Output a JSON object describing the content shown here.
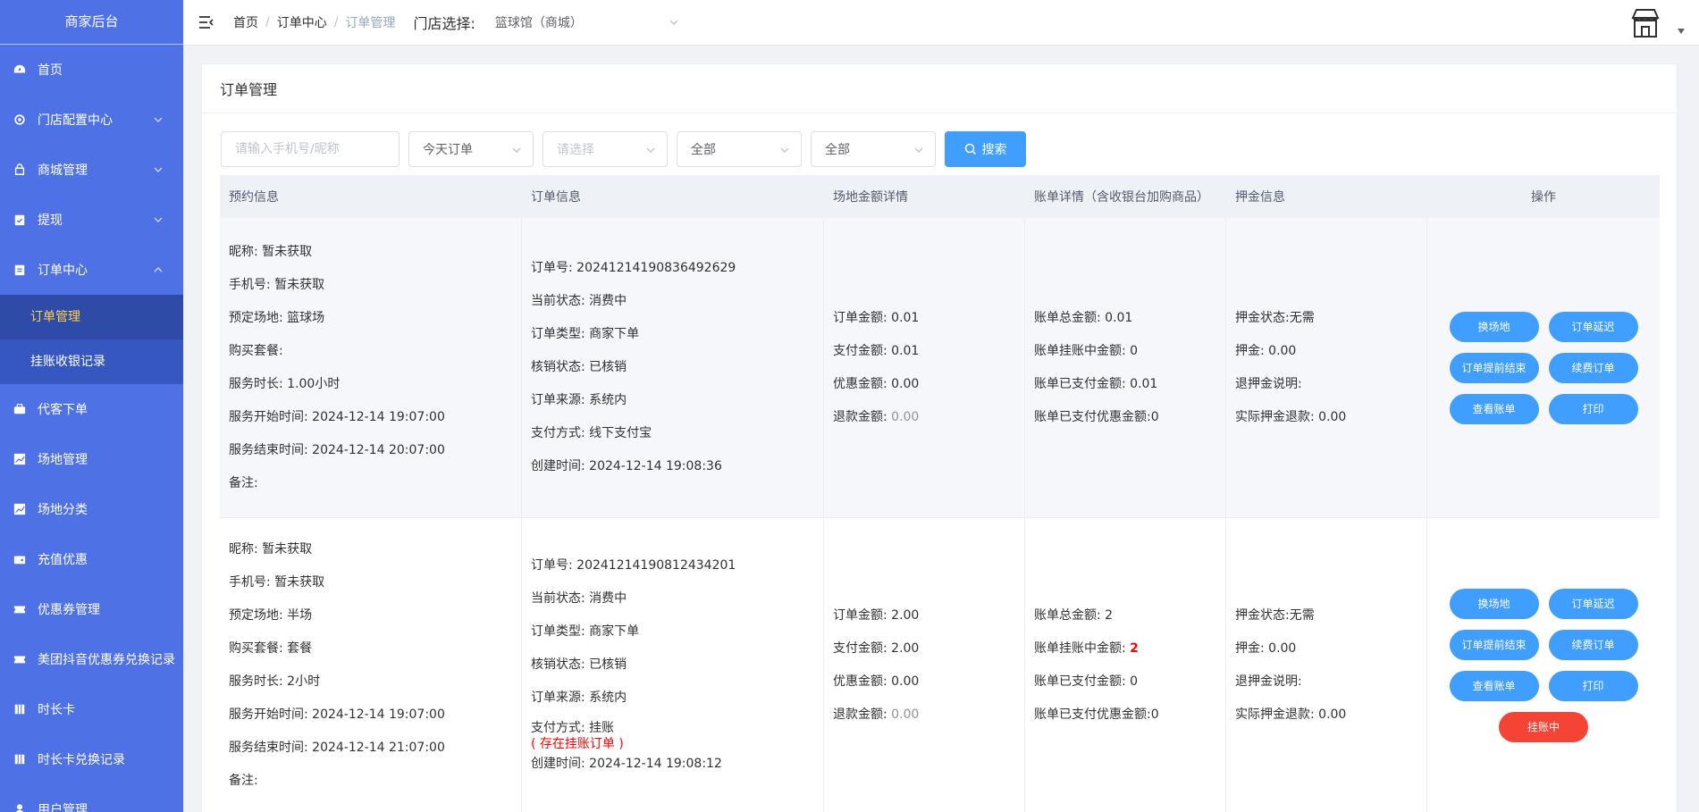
{
  "sidebar": {
    "brand": "商家后台",
    "items": [
      {
        "label": "首页",
        "icon": "dashboard-icon"
      },
      {
        "label": "门店配置中心",
        "icon": "gear-icon"
      },
      {
        "label": "商城管理",
        "icon": "shop-icon"
      },
      {
        "label": "提现",
        "icon": "clipboard-check-icon"
      },
      {
        "label": "订单中心",
        "icon": "clipboard-icon"
      },
      {
        "label": "代客下单",
        "icon": "briefcase-icon"
      },
      {
        "label": "场地管理",
        "icon": "chart-icon"
      },
      {
        "label": "场地分类",
        "icon": "chart-icon"
      },
      {
        "label": "充值优惠",
        "icon": "wallet-icon"
      },
      {
        "label": "优惠券管理",
        "icon": "ticket-icon"
      },
      {
        "label": "美团抖音优惠券兑换记录",
        "icon": "ticket-icon"
      },
      {
        "label": "时长卡",
        "icon": "card-icon"
      },
      {
        "label": "时长卡兑换记录",
        "icon": "card-icon"
      },
      {
        "label": "用户管理",
        "icon": "user-icon"
      }
    ],
    "order_sub": [
      "订单管理",
      "挂账收银记录"
    ]
  },
  "header": {
    "breadcrumb": [
      "首页",
      "订单中心",
      "订单管理"
    ],
    "store_label": "门店选择:",
    "store_value": "篮球馆（商城）"
  },
  "card": {
    "title": "订单管理"
  },
  "filters": {
    "phone_placeholder": "请输入手机号/昵称",
    "date_range": "今天订单",
    "select_placeholder": "请选择",
    "status1": "全部",
    "status2": "全部",
    "search_label": "搜索"
  },
  "table": {
    "headers": [
      "预约信息",
      "订单信息",
      "场地金额详情",
      "账单详情（含收银台加购商品）",
      "押金信息",
      "操作"
    ],
    "rows": [
      {
        "booking": [
          "昵称: 暂未获取",
          "手机号: 暂未获取",
          "预定场地: 篮球场",
          "购买套餐:",
          "服务时长: 1.00小时",
          "服务开始时间: 2024-12-14 19:07:00",
          "服务结束时间: 2024-12-14 20:07:00",
          "备注:"
        ],
        "order": [
          "订单号: 20241214190836492629",
          "当前状态: 消费中",
          "订单类型: 商家下单",
          "核销状态: 已核销",
          "订单来源: 系统内",
          "支付方式: 线下支付宝",
          "创建时间: 2024-12-14 19:08:36"
        ],
        "amount": {
          "order_amount": "订单金额: 0.01",
          "paid": "支付金额: 0.01",
          "discount": "优惠金额: 0.00",
          "refund_label": "退款金额: ",
          "refund_value": "0.00"
        },
        "bill": {
          "total": "账单总金额: 0.01",
          "pending_label": "账单挂账中金额: ",
          "pending_value": "0",
          "paid": "账单已支付金额: 0.01",
          "paid_discount": "账单已支付优惠金额:0"
        },
        "deposit": [
          "押金状态:无需",
          "押金: 0.00",
          "退押金说明:",
          "实际押金退款: 0.00"
        ],
        "ops": [
          "换场地",
          "订单延迟",
          "订单提前结束",
          "续费订单",
          "查看账单",
          "打印"
        ]
      },
      {
        "booking": [
          "昵称: 暂未获取",
          "手机号: 暂未获取",
          "预定场地: 半场",
          "购买套餐: 套餐",
          "服务时长: 2小时",
          "服务开始时间: 2024-12-14 19:07:00",
          "服务结束时间: 2024-12-14 21:07:00",
          "备注:"
        ],
        "order": [
          "订单号: 20241214190812434201",
          "当前状态: 消费中",
          "订单类型: 商家下单",
          "核销状态: 已核销",
          "订单来源: 系统内",
          "支付方式: 挂账",
          "创建时间: 2024-12-14 19:08:12"
        ],
        "order_warn": "( 存在挂账订单 )",
        "amount": {
          "order_amount": "订单金额: 2.00",
          "paid": "支付金额: 2.00",
          "discount": "优惠金额: 0.00",
          "refund_label": "退款金额: ",
          "refund_value": "0.00"
        },
        "bill": {
          "total": "账单总金额: 2",
          "pending_label": "账单挂账中金额: ",
          "pending_value": "2",
          "paid": "账单已支付金额: 0",
          "paid_discount": "账单已支付优惠金额:0"
        },
        "deposit": [
          "押金状态:无需",
          "押金: 0.00",
          "退押金说明:",
          "实际押金退款: 0.00"
        ],
        "ops": [
          "换场地",
          "订单延迟",
          "订单提前结束",
          "续费订单",
          "查看账单",
          "打印"
        ],
        "ops_extra": "挂账中"
      }
    ]
  },
  "colors": {
    "sidebar": "#4f71e6",
    "primary": "#409eff",
    "danger": "#f54336",
    "active_text": "#ffd04b"
  }
}
